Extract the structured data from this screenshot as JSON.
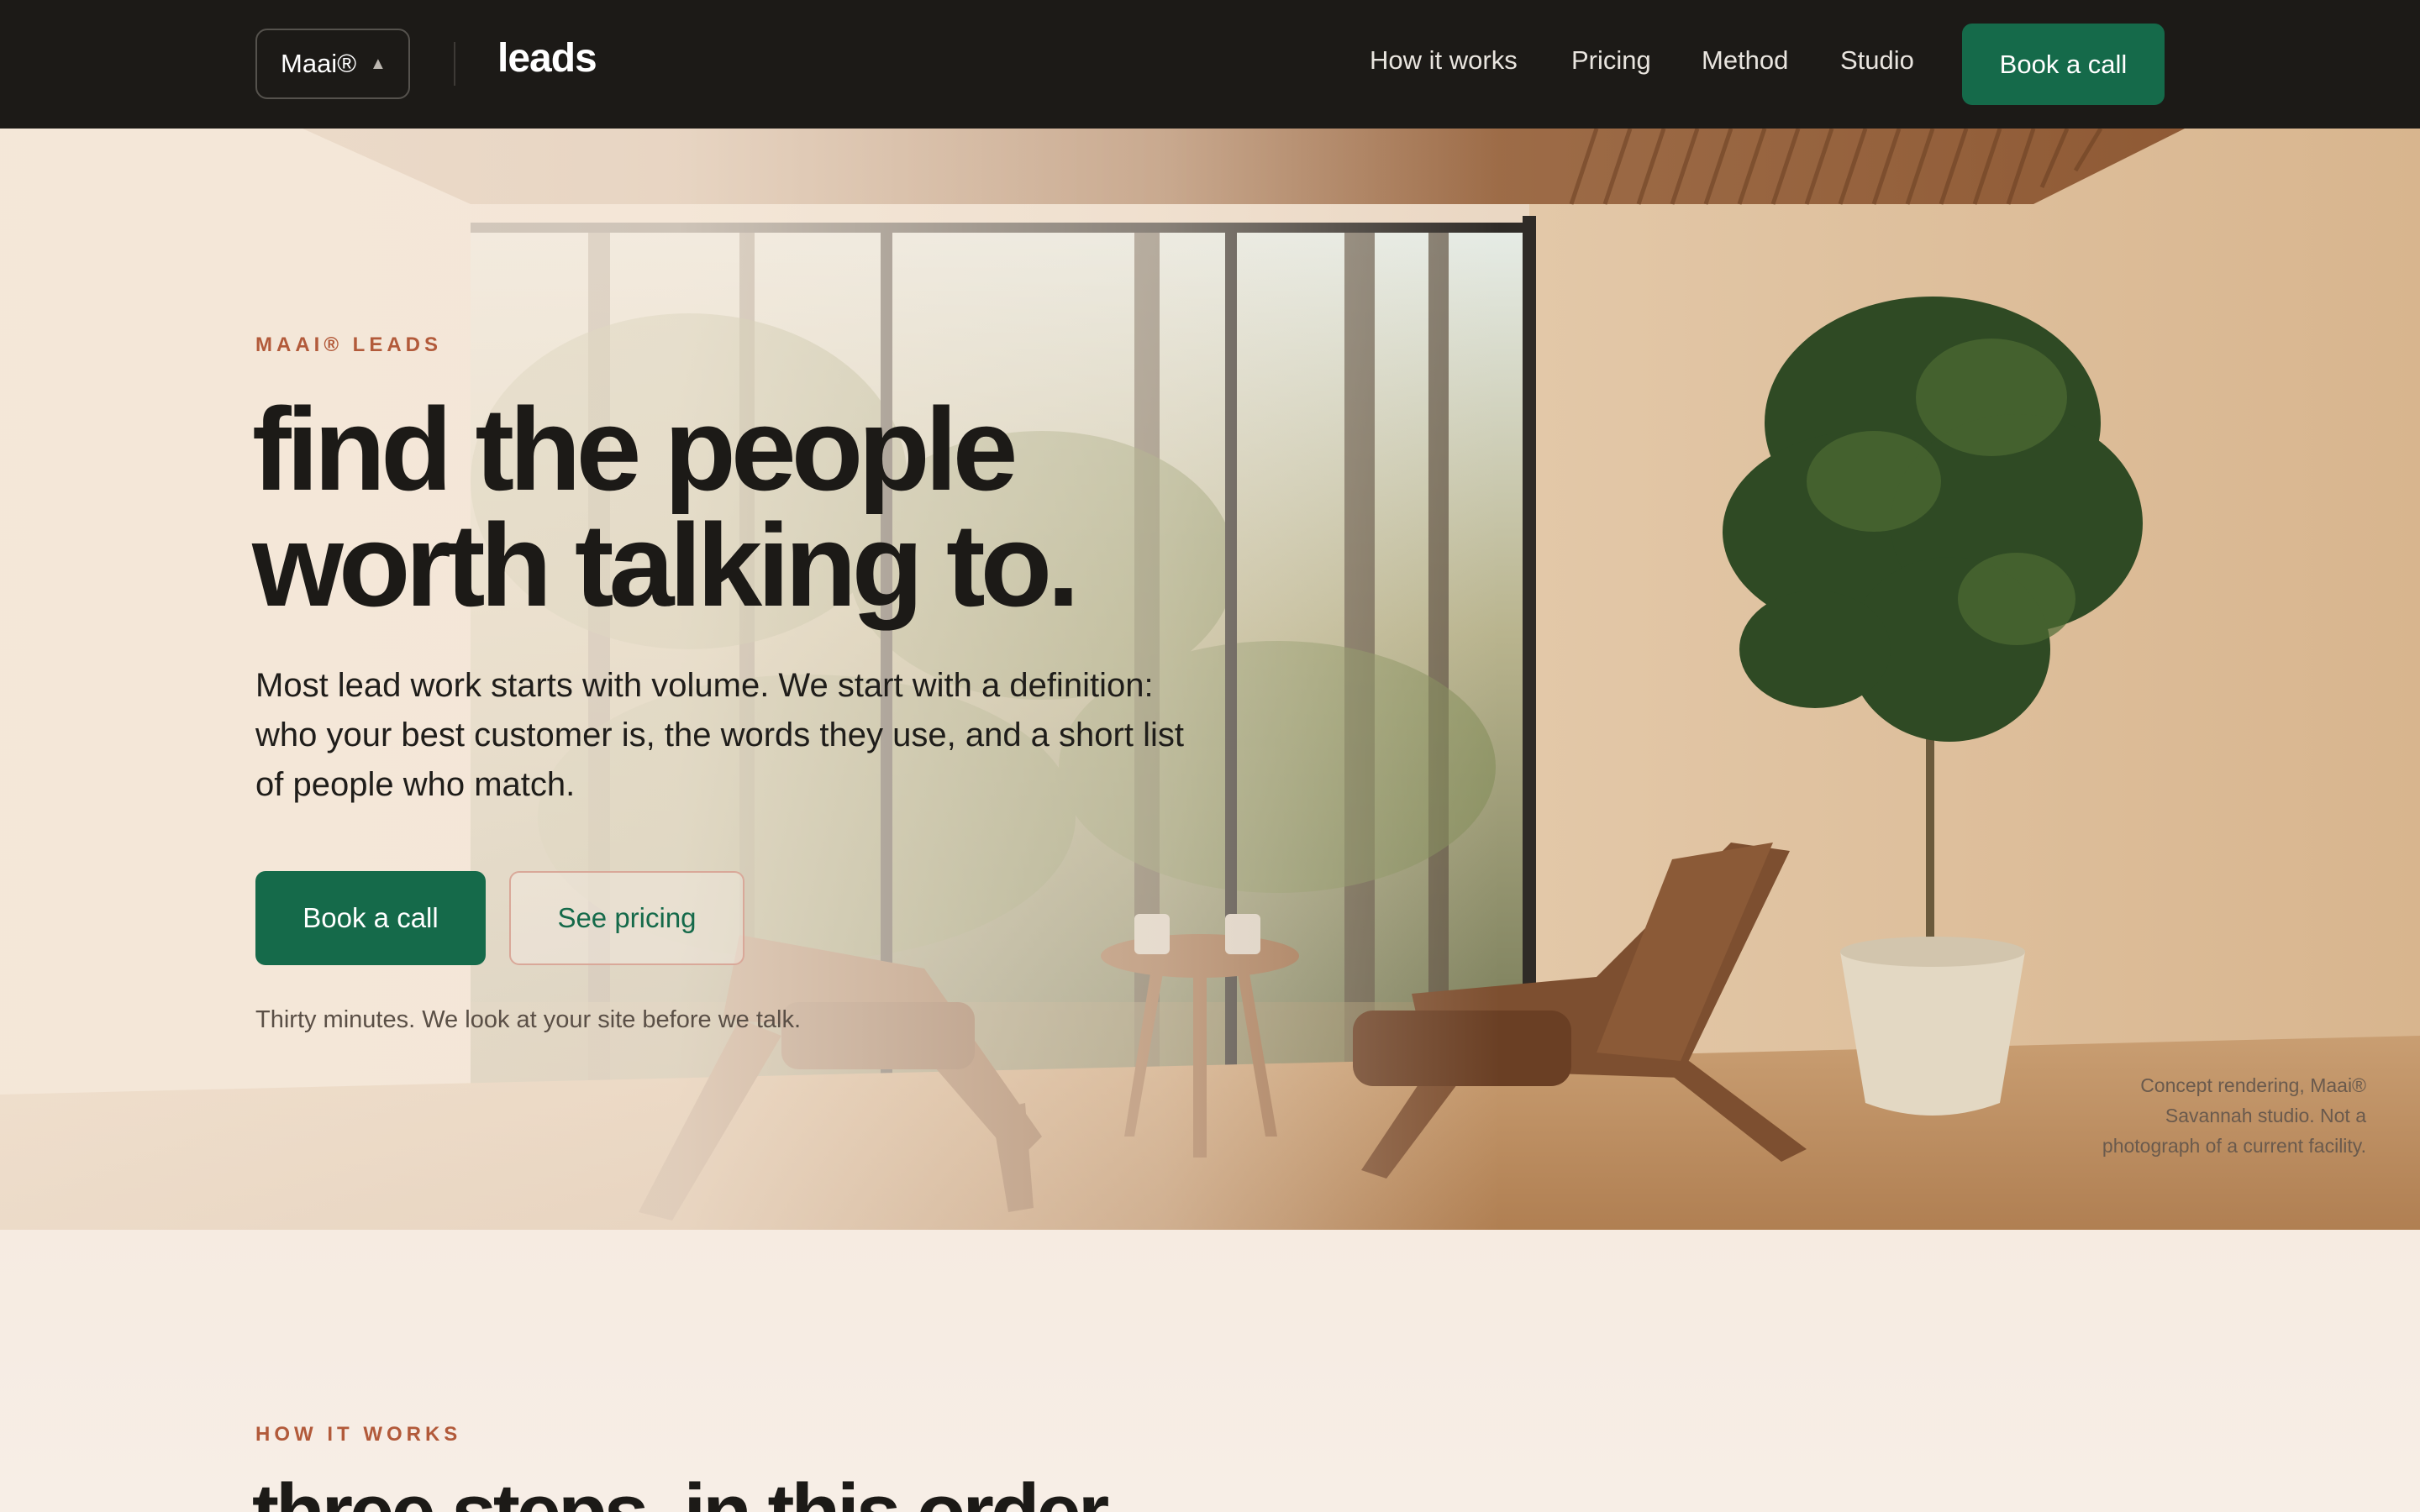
{
  "nav": {
    "brand_switcher": "Maai®",
    "brand_caret": "▲",
    "wordmark": "leads",
    "links": [
      "How it works",
      "Pricing",
      "Method",
      "Studio"
    ],
    "cta": "Book a call"
  },
  "hero": {
    "eyebrow": "MAAI® LEADS",
    "title_line1": "find the people",
    "title_line2": "worth talking to.",
    "lead": "Most lead work starts with volume. We start with a definition: who your best customer is, the words they use, and a short list of people who match.",
    "primary_cta": "Book a call",
    "secondary_cta": "See pricing",
    "note": "Thirty minutes. We look at your site before we talk.",
    "caption": "Concept rendering, Maai® Savannah studio. Not a photograph of a current facility."
  },
  "how_it_works": {
    "eyebrow": "HOW IT WORKS",
    "title": "three steps, in this order."
  },
  "colors": {
    "nav_bg": "#1c1a17",
    "accent_green": "#156a4a",
    "eyebrow_rust": "#b25a3a",
    "page_bg": "#f5ece3"
  }
}
